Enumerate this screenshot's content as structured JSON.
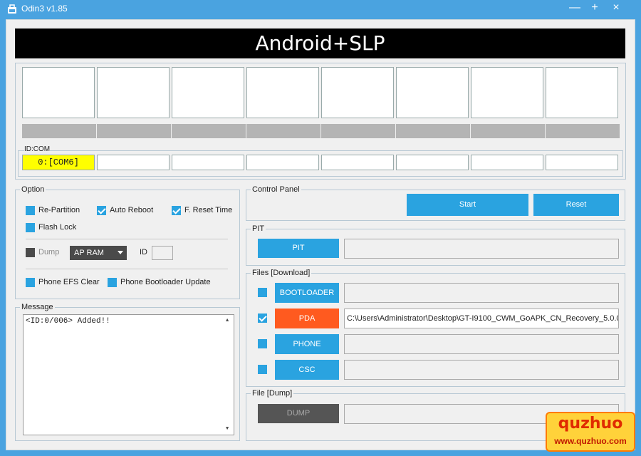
{
  "window": {
    "title": "Odin3 v1.85",
    "minimize": "—",
    "maximize": "+",
    "close": "×"
  },
  "banner": "Android+SLP",
  "ports": {
    "idcom_label": "ID:COM",
    "slots": [
      "0:[COM6]",
      "",
      "",
      "",
      "",
      "",
      "",
      ""
    ],
    "active_slot_color": "#ffff00"
  },
  "option": {
    "label": "Option",
    "re_partition": "Re-Partition",
    "auto_reboot": "Auto Reboot",
    "f_reset_time": "F. Reset Time",
    "flash_lock": "Flash Lock",
    "dump": "Dump",
    "dump_select": "AP RAM",
    "id_label": "ID",
    "phone_efs_clear": "Phone EFS Clear",
    "phone_bootloader_update": "Phone Bootloader Update"
  },
  "message": {
    "label": "Message",
    "text": "<ID:0/006> Added!!"
  },
  "control_panel": {
    "label": "Control Panel",
    "start": "Start",
    "reset": "Reset"
  },
  "pit": {
    "label": "PIT",
    "button": "PIT"
  },
  "files": {
    "label": "Files [Download]",
    "bootloader": "BOOTLOADER",
    "pda": "PDA",
    "pda_path": "C:\\Users\\Administrator\\Desktop\\GT-I9100_CWM_GoAPK_CN_Recovery_5.0.0.",
    "phone": "PHONE",
    "csc": "CSC"
  },
  "file_dump": {
    "label": "File [Dump]",
    "button": "DUMP"
  },
  "watermark": {
    "top": "quzhuo",
    "bottom": "www.quzhuo.com"
  },
  "colors": {
    "accent": "#2aa3e0",
    "pda_button": "#ff5a1f",
    "titlebar": "#4aa3e0"
  }
}
